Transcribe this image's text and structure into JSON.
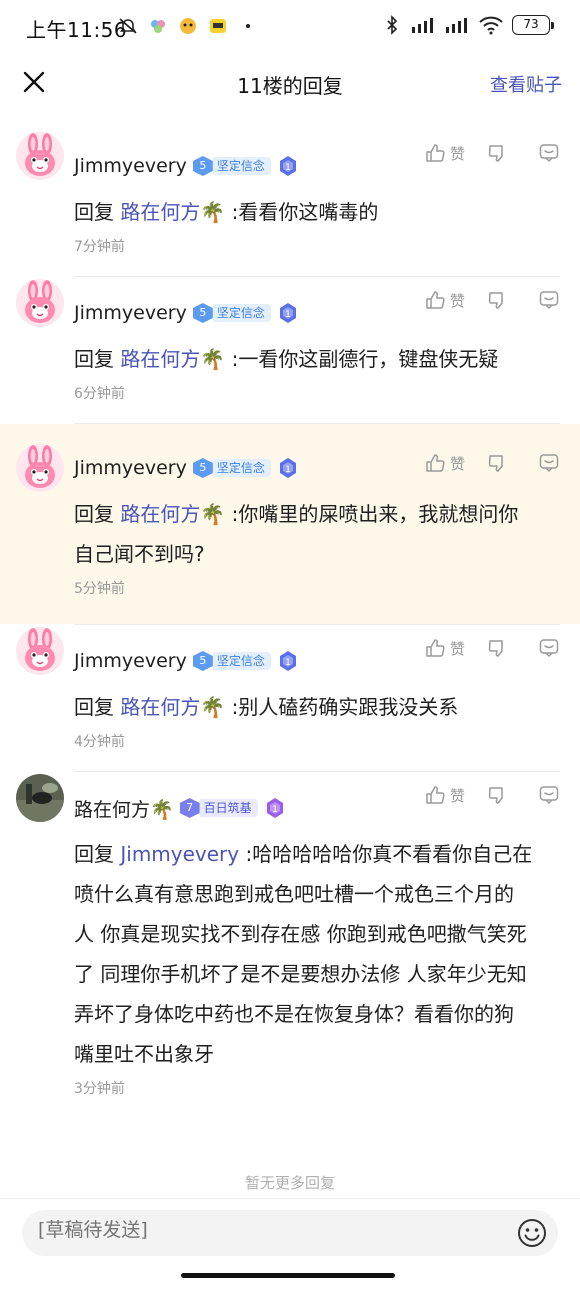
{
  "status_bar": {
    "time": "上午11:56",
    "battery": "73"
  },
  "nav": {
    "title": "11楼的回复",
    "view_post": "查看贴子"
  },
  "reply_prefix": "回复",
  "like_label": "赞",
  "replies": [
    {
      "user": "Jimmyevery",
      "level": "5",
      "level_name": "坚定信念",
      "mention": "路在何方🌴",
      "text": ":看看你这嘴毒的",
      "time": "7分钟前",
      "avatar": "pink-bunny-avatar"
    },
    {
      "user": "Jimmyevery",
      "level": "5",
      "level_name": "坚定信念",
      "mention": "路在何方🌴",
      "text": ":一看你这副德行，键盘侠无疑",
      "time": "6分钟前",
      "avatar": "pink-bunny-avatar"
    },
    {
      "user": "Jimmyevery",
      "level": "5",
      "level_name": "坚定信念",
      "mention": "路在何方🌴",
      "text": ":你嘴里的屎喷出来，我就想问你",
      "text2": "自己闻不到吗?",
      "time": "5分钟前",
      "avatar": "pink-bunny-avatar",
      "highlighted": true
    },
    {
      "user": "Jimmyevery",
      "level": "5",
      "level_name": "坚定信念",
      "mention": "路在何方🌴",
      "text": ":别人磕药确实跟我没关系",
      "time": "4分钟前",
      "avatar": "pink-bunny-avatar"
    },
    {
      "user": "路在何方🌴",
      "level": "7",
      "level_name": "百日筑基",
      "mention": "Jimmyevery",
      "text": ":哈哈哈哈哈你真不看看你自己在",
      "lines": [
        "喷什么真有意思跑到戒色吧吐槽一个戒色三个月的",
        "人 你真是现实找不到存在感 你跑到戒色吧撒气笑死",
        "了 同理你手机坏了是不是要想办法修 人家年少无知",
        "弄坏了身体吃中药也不是在恢复身体？看看你的狗",
        "嘴里吐不出象牙"
      ],
      "time": "3分钟前",
      "avatar": "dark-photo-avatar"
    }
  ],
  "no_more": "暂无更多回复",
  "draft": {
    "placeholder": "[草稿待发送]"
  }
}
